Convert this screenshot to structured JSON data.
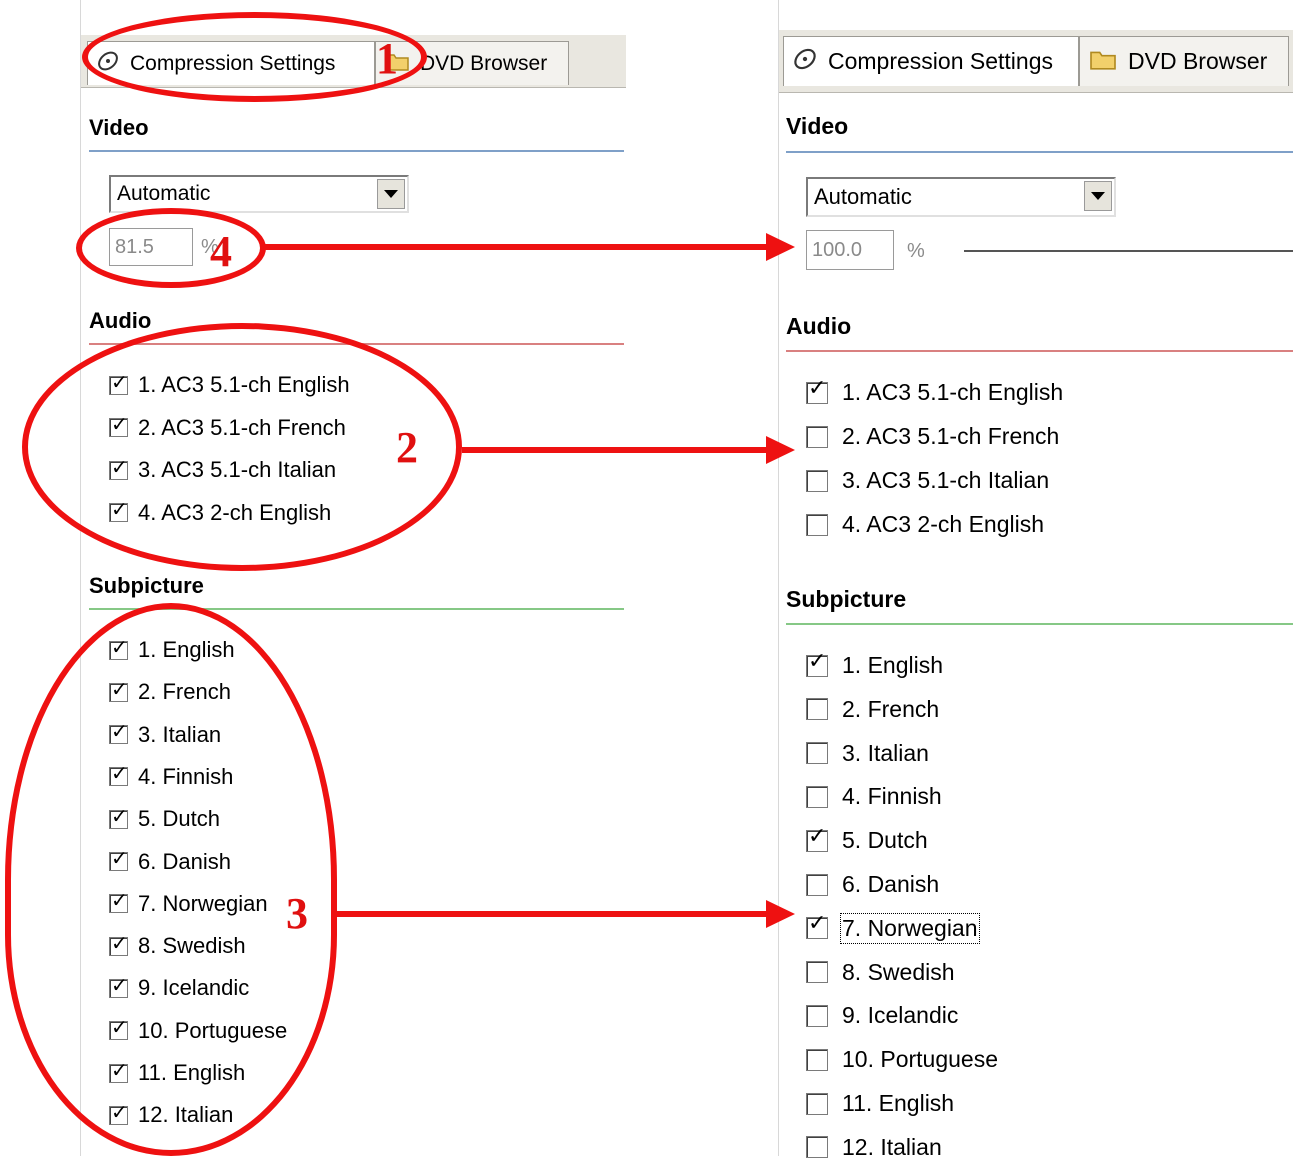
{
  "left_panel": {
    "tabs": [
      {
        "label": "Compression Settings",
        "active": true
      },
      {
        "label": "DVD Browser",
        "active": false
      }
    ],
    "video": {
      "title": "Video",
      "mode": "Automatic",
      "percent": "81.5",
      "percent_unit": "%"
    },
    "audio": {
      "title": "Audio",
      "tracks": [
        {
          "label": "1. AC3 5.1-ch English",
          "checked": true
        },
        {
          "label": "2. AC3 5.1-ch French",
          "checked": true
        },
        {
          "label": "3. AC3 5.1-ch Italian",
          "checked": true
        },
        {
          "label": "4. AC3 2-ch English",
          "checked": true
        }
      ]
    },
    "subpicture": {
      "title": "Subpicture",
      "tracks": [
        {
          "label": "1. English",
          "checked": true
        },
        {
          "label": "2. French",
          "checked": true
        },
        {
          "label": "3. Italian",
          "checked": true
        },
        {
          "label": "4. Finnish",
          "checked": true
        },
        {
          "label": "5. Dutch",
          "checked": true
        },
        {
          "label": "6. Danish",
          "checked": true
        },
        {
          "label": "7. Norwegian",
          "checked": true
        },
        {
          "label": "8. Swedish",
          "checked": true
        },
        {
          "label": "9. Icelandic",
          "checked": true
        },
        {
          "label": "10. Portuguese",
          "checked": true
        },
        {
          "label": "11. English",
          "checked": true
        },
        {
          "label": "12. Italian",
          "checked": true
        }
      ]
    }
  },
  "right_panel": {
    "tabs": [
      {
        "label": "Compression Settings",
        "active": true
      },
      {
        "label": "DVD Browser",
        "active": false
      }
    ],
    "video": {
      "title": "Video",
      "mode": "Automatic",
      "percent": "100.0",
      "percent_unit": "%"
    },
    "audio": {
      "title": "Audio",
      "tracks": [
        {
          "label": "1. AC3 5.1-ch English",
          "checked": true
        },
        {
          "label": "2. AC3 5.1-ch French",
          "checked": false
        },
        {
          "label": "3. AC3 5.1-ch Italian",
          "checked": false
        },
        {
          "label": "4. AC3 2-ch English",
          "checked": false
        }
      ]
    },
    "subpicture": {
      "title": "Subpicture",
      "tracks": [
        {
          "label": "1. English",
          "checked": true
        },
        {
          "label": "2. French",
          "checked": false
        },
        {
          "label": "3. Italian",
          "checked": false
        },
        {
          "label": "4. Finnish",
          "checked": false
        },
        {
          "label": "5. Dutch",
          "checked": true
        },
        {
          "label": "6. Danish",
          "checked": false
        },
        {
          "label": "7. Norwegian",
          "checked": true,
          "focused": true
        },
        {
          "label": "8. Swedish",
          "checked": false
        },
        {
          "label": "9. Icelandic",
          "checked": false
        },
        {
          "label": "10. Portuguese",
          "checked": false
        },
        {
          "label": "11. English",
          "checked": false
        },
        {
          "label": "12. Italian",
          "checked": false
        }
      ]
    }
  },
  "annotations": [
    "1",
    "2",
    "3",
    "4"
  ],
  "colors": {
    "annotation": "#ee1111",
    "video_rule": "#7fa0c8",
    "audio_rule": "#d98080",
    "subpicture_rule": "#86c886"
  },
  "icons": {
    "compression_tab": "disc-icon",
    "browser_tab": "folder-icon"
  }
}
